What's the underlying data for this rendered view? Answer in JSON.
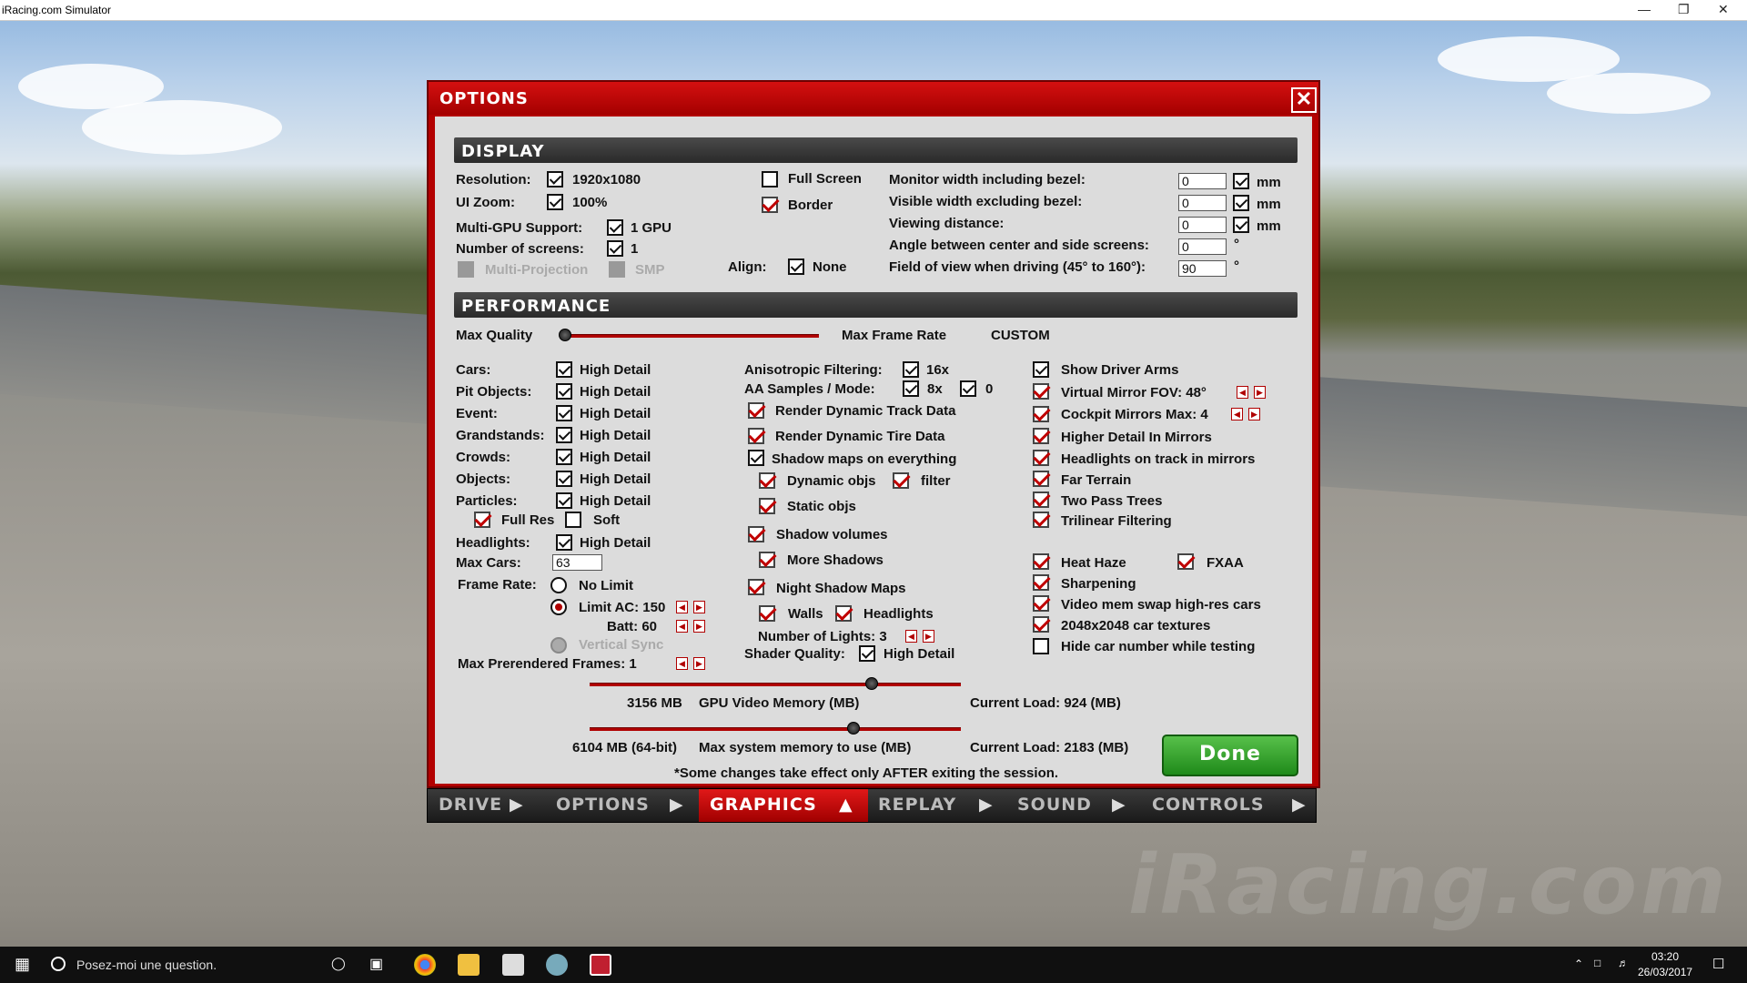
{
  "window": {
    "title": "iRacing.com Simulator"
  },
  "dialog": {
    "title": "OPTIONS",
    "close": "✕"
  },
  "display": {
    "header": "DISPLAY",
    "resolution_label": "Resolution:",
    "resolution_value": "1920x1080",
    "uizoom_label": "UI Zoom:",
    "uizoom_value": "100%",
    "multigpu_label": "Multi-GPU Support:",
    "multigpu_value": "1 GPU",
    "screens_label": "Number of screens:",
    "screens_value": "1",
    "multiprojection": "Multi-Projection",
    "smp": "SMP",
    "fullscreen": "Full Screen",
    "border": "Border",
    "align_label": "Align:",
    "align_value": "None",
    "monitor_width_label": "Monitor width including bezel:",
    "monitor_width_value": "0",
    "visible_width_label": "Visible width excluding bezel:",
    "visible_width_value": "0",
    "viewing_distance_label": "Viewing distance:",
    "viewing_distance_value": "0",
    "angle_label": "Angle between center and side screens:",
    "angle_value": "0",
    "fov_label": "Field of view when driving (45° to 160°):",
    "fov_value": "90",
    "unit_mm": "mm",
    "unit_deg": "°"
  },
  "performance": {
    "header": "PERFORMANCE",
    "max_quality": "Max Quality",
    "max_frame_rate": "Max Frame Rate",
    "preset": "CUSTOM",
    "quality_slider": 0.0,
    "detail_rows": [
      {
        "label": "Cars:",
        "value": "High Detail"
      },
      {
        "label": "Pit Objects:",
        "value": "High Detail"
      },
      {
        "label": "Event:",
        "value": "High Detail"
      },
      {
        "label": "Grandstands:",
        "value": "High Detail"
      },
      {
        "label": "Crowds:",
        "value": "High Detail"
      },
      {
        "label": "Objects:",
        "value": "High Detail"
      },
      {
        "label": "Particles:",
        "value": "High Detail"
      }
    ],
    "full_res": "Full Res",
    "soft": "Soft",
    "headlights_label": "Headlights:",
    "headlights_value": "High Detail",
    "max_cars_label": "Max Cars:",
    "max_cars_value": "63",
    "frame_rate_label": "Frame Rate:",
    "no_limit": "No Limit",
    "limit_ac": "Limit AC: 150",
    "batt": "Batt: 60",
    "vsync": "Vertical Sync",
    "max_prerendered": "Max Prerendered Frames: 1",
    "aniso_label": "Anisotropic Filtering:",
    "aniso_value": "16x",
    "aa_label": "AA Samples / Mode:",
    "aa_value": "8x",
    "aa_mode": "0",
    "render_track": "Render Dynamic Track Data",
    "render_tire": "Render Dynamic Tire Data",
    "shadow_maps": "Shadow maps on everything",
    "dynamic_objs": "Dynamic objs",
    "filter": "filter",
    "static_objs": "Static objs",
    "shadow_volumes": "Shadow volumes",
    "more_shadows": "More Shadows",
    "night_shadow": "Night Shadow Maps",
    "walls": "Walls",
    "headlights2": "Headlights",
    "num_lights": "Number of Lights: 3",
    "shader_label": "Shader Quality:",
    "shader_value": "High Detail",
    "show_arms": "Show Driver Arms",
    "virtual_mirror": "Virtual Mirror  FOV:  48°",
    "cockpit_mirrors": "Cockpit Mirrors  Max:  4",
    "higher_detail_mirrors": "Higher Detail In Mirrors",
    "headlights_mirrors": "Headlights on track in mirrors",
    "far_terrain": "Far Terrain",
    "two_pass": "Two Pass Trees",
    "trilinear": "Trilinear Filtering",
    "heat_haze": "Heat Haze",
    "fxaa": "FXAA",
    "sharpening": "Sharpening",
    "vidmem_swap": "Video mem swap high-res cars",
    "textures": "2048x2048 car textures",
    "hide_number": "Hide car number while testing",
    "gpu_mem_value": "3156 MB",
    "gpu_mem_label": "GPU Video Memory (MB)",
    "gpu_load": "Current Load: 924 (MB)",
    "gpu_slider": 0.76,
    "sys_mem_value": "6104 MB (64-bit)",
    "sys_mem_label": "Max system memory to use (MB)",
    "sys_load": "Current Load: 2183 (MB)",
    "sys_slider": 0.71,
    "note": "*Some changes take effect only AFTER exiting the session."
  },
  "done_button": "Done",
  "nav": [
    "DRIVE",
    "OPTIONS",
    "GRAPHICS",
    "REPLAY",
    "SOUND",
    "CONTROLS"
  ],
  "nav_active": "GRAPHICS",
  "taskbar": {
    "search_placeholder": "Posez-moi une question.",
    "time": "03:20",
    "date": "26/03/2017"
  },
  "colors": {
    "accent": "#b30000",
    "panel": "#dcdcdc",
    "done": "#3aa630"
  }
}
